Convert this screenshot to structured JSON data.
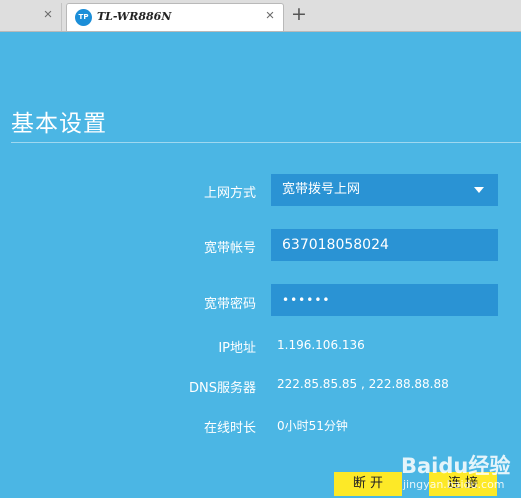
{
  "browser": {
    "tabs": [
      {
        "label": ""
      },
      {
        "label": "TL-WR886N",
        "favicon": "TP"
      }
    ],
    "close_glyph": "×",
    "newtab_glyph": "+"
  },
  "page": {
    "title": "基本设置",
    "fields": {
      "connection_type": {
        "label": "上网方式",
        "value": "宽带拨号上网"
      },
      "account": {
        "label": "宽带帐号",
        "value": "637018058024"
      },
      "password": {
        "label": "宽带密码",
        "value": "••••••"
      }
    },
    "info": {
      "ip": {
        "label": "IP地址",
        "value": "1.196.106.136"
      },
      "dns": {
        "label": "DNS服务器",
        "value": "222.85.85.85 , 222.88.88.88"
      },
      "online": {
        "label": "在线时长",
        "value": "0小时51分钟"
      }
    },
    "buttons": {
      "disconnect": "断 开",
      "connect": "连 接"
    },
    "watermark": {
      "main": "Baidu经验",
      "sub": "jingyan.baidu.com"
    }
  },
  "colors": {
    "background": "#4bb6e4",
    "field": "#2a93d4",
    "button": "#fde927"
  }
}
